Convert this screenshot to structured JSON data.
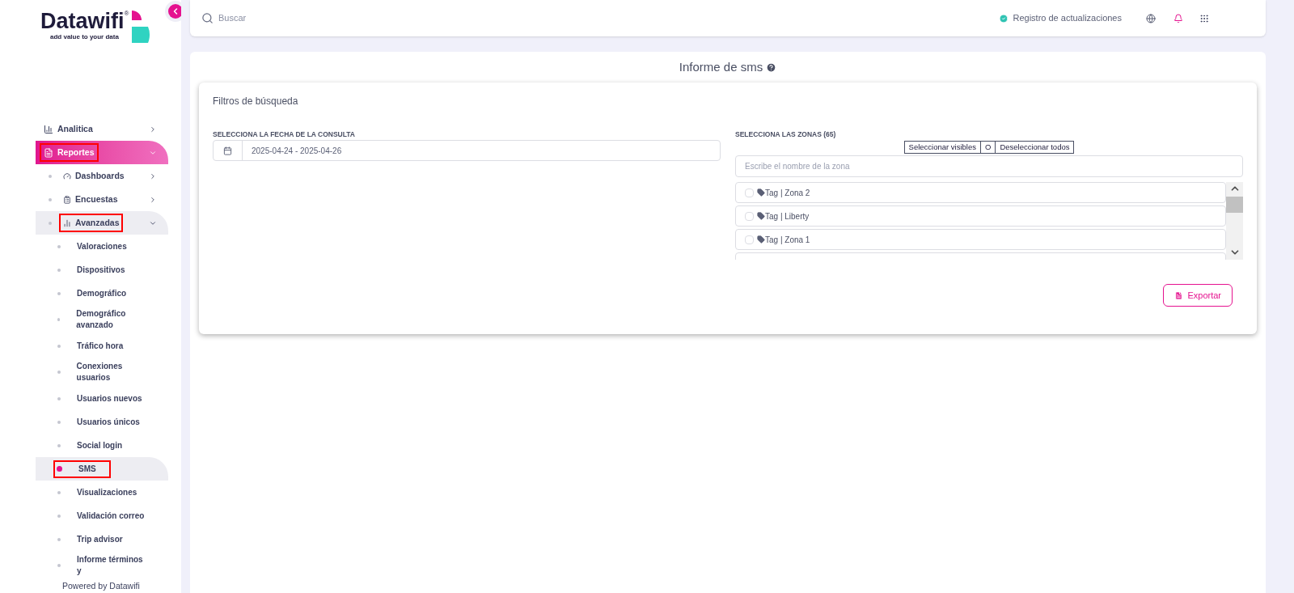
{
  "sidebar": {
    "logo": {
      "name": "Datawifi",
      "mark": "®",
      "tagline": "add value to your data"
    },
    "nav": [
      {
        "label": "Analitica",
        "expanded": false,
        "selected": false,
        "annotated": false
      },
      {
        "label": "Reportes",
        "expanded": true,
        "selected": true,
        "annotated": true,
        "children": [
          {
            "label": "Dashboards",
            "expanded": false,
            "selected": false,
            "annotated": false
          },
          {
            "label": "Encuestas",
            "expanded": false,
            "selected": false,
            "annotated": false
          },
          {
            "label": "Avanzadas",
            "expanded": true,
            "selected": true,
            "annotated": true,
            "children": [
              {
                "label": "Valoraciones",
                "selected": false,
                "annotated": false
              },
              {
                "label": "Dispositivos",
                "selected": false,
                "annotated": false
              },
              {
                "label": "Demográfico",
                "selected": false,
                "annotated": false
              },
              {
                "label": "Demográfico avanzado",
                "selected": false,
                "annotated": false
              },
              {
                "label": "Tráfico hora",
                "selected": false,
                "annotated": false
              },
              {
                "label": "Conexiones usuarios",
                "selected": false,
                "annotated": false
              },
              {
                "label": "Usuarios nuevos",
                "selected": false,
                "annotated": false
              },
              {
                "label": "Usuarios únicos",
                "selected": false,
                "annotated": false
              },
              {
                "label": "Social login",
                "selected": false,
                "annotated": false
              },
              {
                "label": "SMS",
                "selected": true,
                "annotated": true
              },
              {
                "label": "Visualizaciones",
                "selected": false,
                "annotated": false
              },
              {
                "label": "Validación correo",
                "selected": false,
                "annotated": false
              },
              {
                "label": "Trip advisor",
                "selected": false,
                "annotated": false
              },
              {
                "label": "Informe términos y",
                "selected": false,
                "annotated": false
              }
            ]
          }
        ]
      }
    ],
    "footer": "Powered by Datawifi"
  },
  "topbar": {
    "search": {
      "placeholder": "Buscar"
    },
    "changelog": "Registro de actualizaciones"
  },
  "page": {
    "title": "Informe de sms",
    "filters": {
      "title": "Filtros de búsqueda",
      "date": {
        "label": "SELECCIONA LA FECHA DE LA CONSULTA",
        "value": "2025-04-24 - 2025-04-26"
      },
      "zones": {
        "label": "SELECCIONA LAS ZONAS (65)",
        "actions": [
          "Seleccionar visibles",
          "O",
          "Deseleccionar todos"
        ],
        "search": {
          "placeholder": "Escribe el nombre de la zona"
        },
        "items": [
          {
            "label": "Tag | Zona 2",
            "checked": false
          },
          {
            "label": "Tag | Liberty",
            "checked": false
          },
          {
            "label": "Tag | Zona 1",
            "checked": false
          }
        ]
      },
      "export": "Exportar"
    }
  }
}
